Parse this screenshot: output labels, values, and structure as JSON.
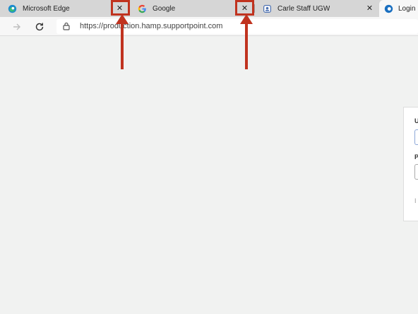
{
  "tabs": [
    {
      "title": "Microsoft Edge",
      "favicon": "edge-icon",
      "close": "✕"
    },
    {
      "title": "Google",
      "favicon": "google-icon",
      "close": "✕"
    },
    {
      "title": "Carle Staff UGW",
      "favicon": "ugw-icon",
      "close": "✕"
    },
    {
      "title": "Login :",
      "favicon": "edge-icon",
      "close": ""
    }
  ],
  "toolbar": {
    "url": "https://production.hamp.supportpoint.com",
    "back": "→"
  },
  "colors": {
    "annotation": "#c0331f",
    "page_bg": "#f1f2f1",
    "tab_bg": "#d6d6d6"
  },
  "login_card": {
    "username_label": "U",
    "password_label": "P",
    "remember_text": "I"
  }
}
